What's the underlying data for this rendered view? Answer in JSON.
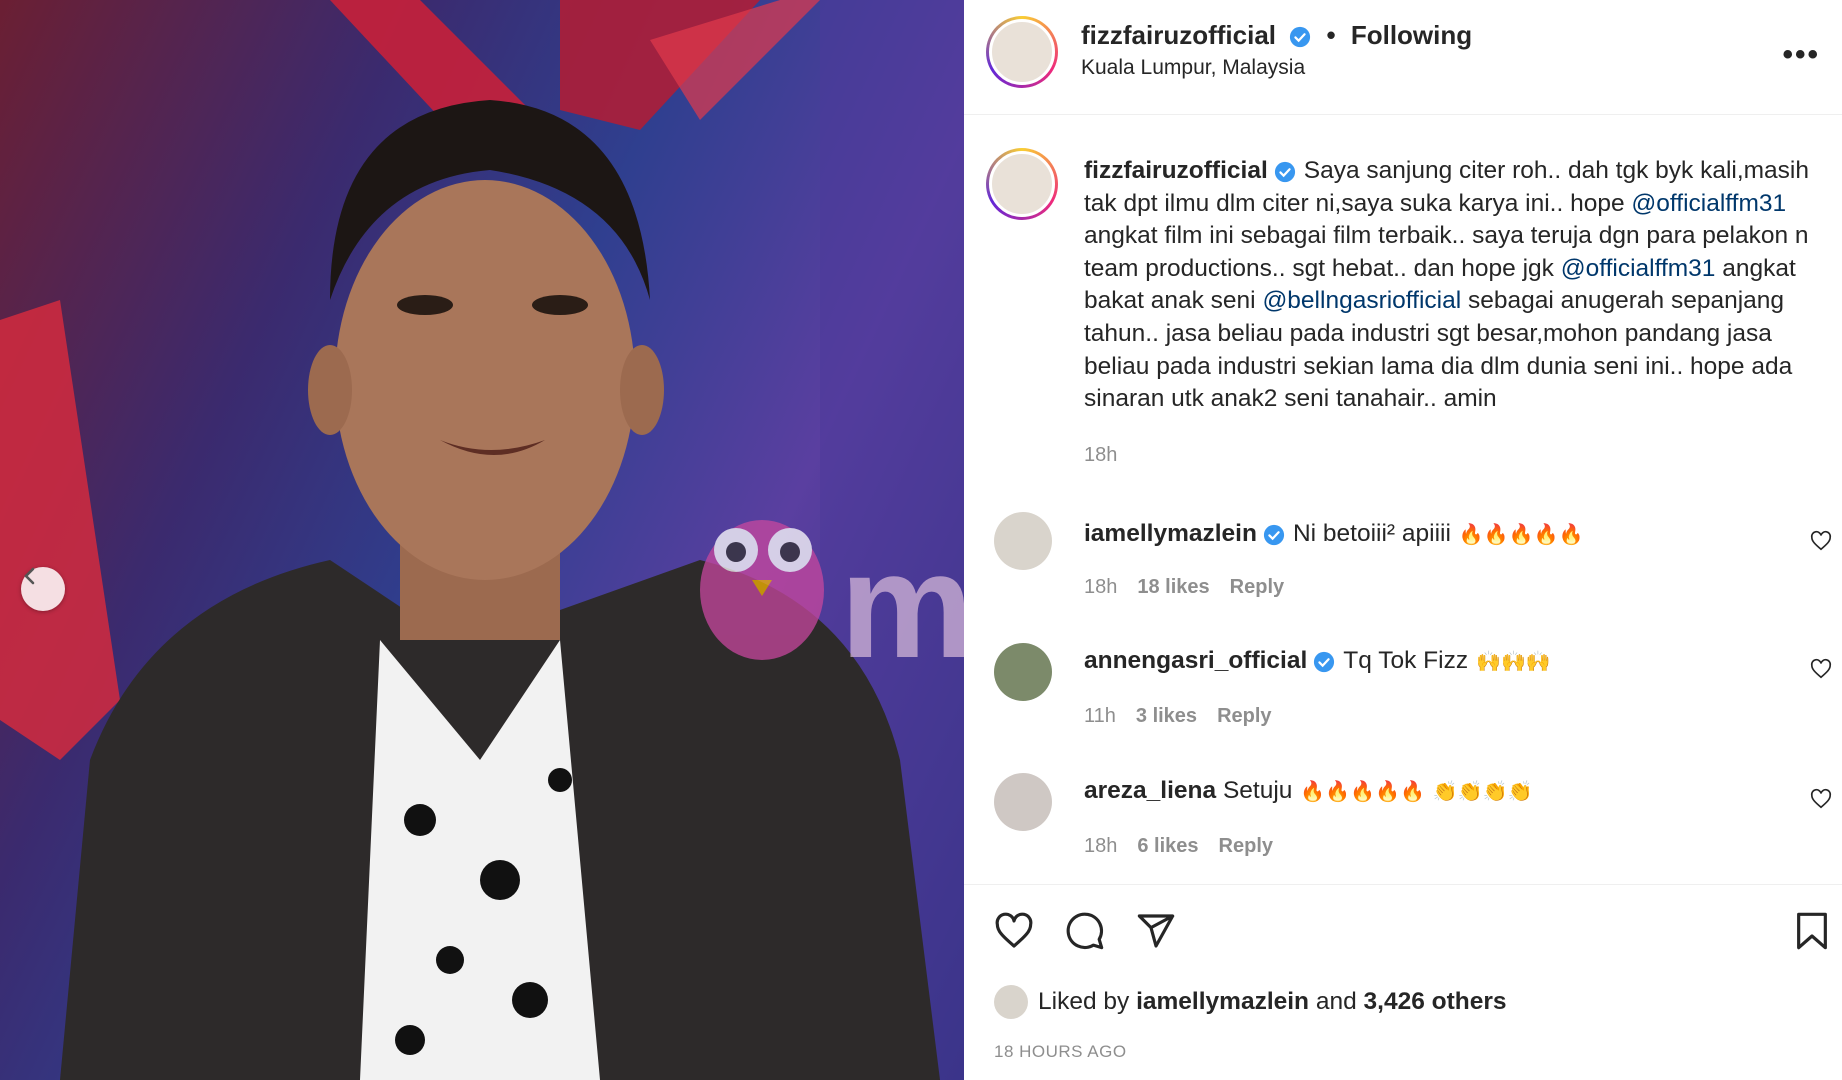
{
  "post_image": {
    "watermark_text": "murai",
    "prev_button_icon": "chevron-left-icon"
  },
  "header": {
    "username": "fizzfairuzofficial",
    "follow_status": "Following",
    "location": "Kuala Lumpur, Malaysia",
    "more_icon": "more-options-icon"
  },
  "caption": {
    "username": "fizzfairuzofficial",
    "seg1": "Saya sanjung citer roh.. dah tgk byk kali,masih tak dpt ilmu dlm citer ni,saya suka karya ini.. hope ",
    "mention1": "@officialffm31",
    "seg2": " angkat film ini sebagai film terbaik.. saya teruja dgn para pelakon n team productions.. sgt hebat.. dan hope jgk ",
    "mention2": "@officialffm31",
    "seg3": " angkat bakat anak seni ",
    "mention3": "@bellngasriofficial",
    "seg4": " sebagai anugerah sepanjang tahun.. jasa beliau pada industri sgt besar,mohon pandang jasa beliau pada industri sekian lama dia dlm dunia seni ini.. hope ada sinaran utk anak2 seni tanahair.. amin",
    "time": "18h"
  },
  "comments": [
    {
      "username": "iamellymazlein",
      "verified": true,
      "text": "Ni betoiii² apiiii",
      "time": "18h",
      "likes": "18 likes",
      "reply": "Reply"
    },
    {
      "username": "annengasri_official",
      "verified": true,
      "text": "Tq Tok Fizz",
      "time": "11h",
      "likes": "3 likes",
      "reply": "Reply"
    },
    {
      "username": "areza_liena",
      "verified": false,
      "text": "Setuju",
      "time": "18h",
      "likes": "6 likes",
      "reply": "Reply"
    }
  ],
  "likes": {
    "prefix": "Liked by",
    "user": "iamellymazlein",
    "middle": "and",
    "others": "3,426 others"
  },
  "posted_ago": "18 HOURS AGO",
  "colors": {
    "link": "#00376b",
    "muted": "#8e8e8e",
    "verified": "#3897f0"
  }
}
